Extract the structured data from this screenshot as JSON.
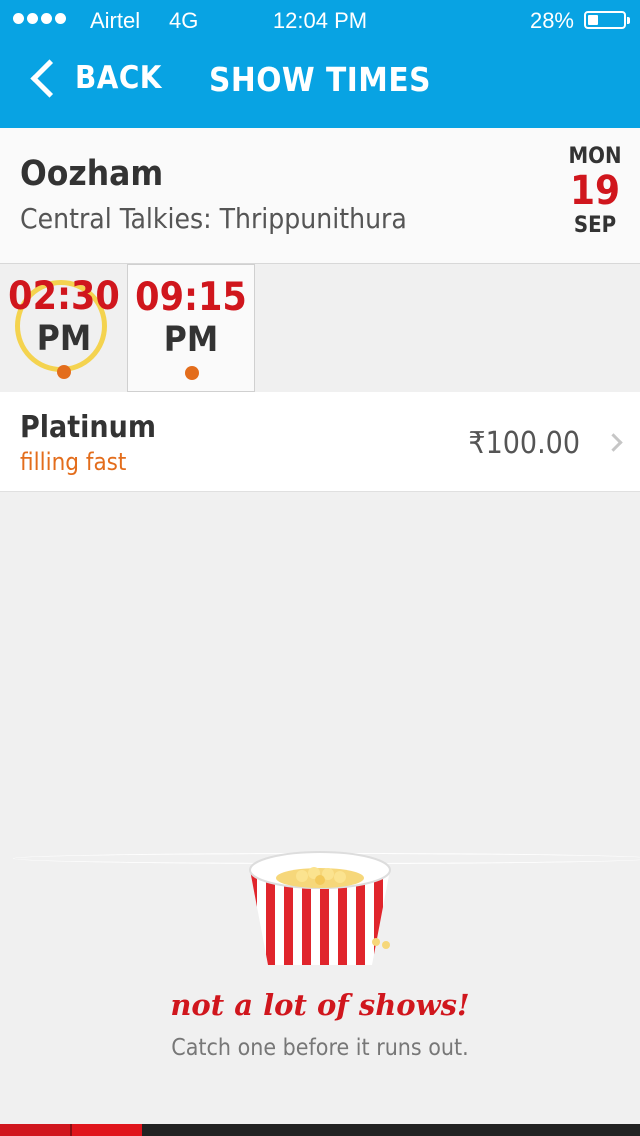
{
  "status_bar": {
    "carrier": "Airtel",
    "network": "4G",
    "time": "12:04 PM",
    "battery": "28%",
    "battery_level": 0.28,
    "signal_strength": 4
  },
  "nav": {
    "back_label": "BACK",
    "title": "SHOW TIMES"
  },
  "movie": {
    "title": "Oozham",
    "theatre": "Central Talkies: Thrippunithura"
  },
  "date": {
    "day": "MON",
    "number": "19",
    "month": "SEP"
  },
  "showtimes": [
    {
      "time": "02:30",
      "period": "PM"
    },
    {
      "time": "09:15",
      "period": "PM"
    }
  ],
  "category": {
    "name": "Platinum",
    "status": "filling fast",
    "price": "₹100.00"
  },
  "empty_state": {
    "tagline": "not a lot of shows!",
    "subtext": "Catch one before it runs out."
  },
  "colors": {
    "header_blue": "#08a3e3",
    "accent_red": "#d0161d",
    "status_orange": "#e36d1c"
  }
}
